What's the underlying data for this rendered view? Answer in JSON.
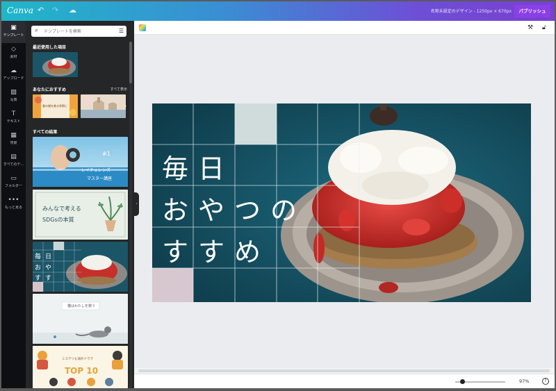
{
  "app": {
    "logo": "Canva",
    "undo_icon": "↶",
    "redo_icon": "↷",
    "cloud_icon": "☁",
    "doc_title": "名称未設定のデザイン - 1250px × 670px",
    "publish_label": "パブリッシュ"
  },
  "rail": [
    {
      "icon": "▣",
      "label": "テンプレート",
      "name": "rail-templates",
      "active": true
    },
    {
      "icon": "◇",
      "label": "素材",
      "name": "rail-elements"
    },
    {
      "icon": "☁",
      "label": "アップロード",
      "name": "rail-uploads"
    },
    {
      "icon": "▨",
      "label": "写真",
      "name": "rail-photos"
    },
    {
      "icon": "T",
      "label": "テキスト",
      "name": "rail-text"
    },
    {
      "icon": "▦",
      "label": "背景",
      "name": "rail-background"
    },
    {
      "icon": "▤",
      "label": "すべてのデ...",
      "name": "rail-all-designs"
    },
    {
      "icon": "▭",
      "label": "フォルダー",
      "name": "rail-folders"
    },
    {
      "icon": "•••",
      "label": "もっと見る",
      "name": "rail-more"
    }
  ],
  "panel": {
    "search_placeholder": "テンプレートを検索",
    "recent_title": "最近使用した項目",
    "recommend_title": "あなたにおすすめ",
    "see_all": "すべて表示",
    "results_title": "すべての結果",
    "thumb_texts": {
      "rec1": "春の服を着る季節に",
      "t1a": "#1",
      "t1b": "レイチェレンズ",
      "t1c": "マスター講座",
      "t2a": "みんなで考える",
      "t2b": "SDGsの本質",
      "t3a": "毎",
      "t3b": "日",
      "t3c": "お",
      "t3d": "や",
      "t3e": "す",
      "t3f": "す",
      "t4": "猫はわたしを救う",
      "t5a": "ミステリも海外ドラマ",
      "t5b": "TOP 10"
    }
  },
  "canvas": {
    "zoom": "97%",
    "zoom_level": 0.14,
    "help": "?",
    "design_lines": [
      "毎日",
      "おやつの",
      "すすめ"
    ]
  },
  "colors": {
    "publish": "#8b3fe6",
    "design_bg": "#164f60"
  }
}
